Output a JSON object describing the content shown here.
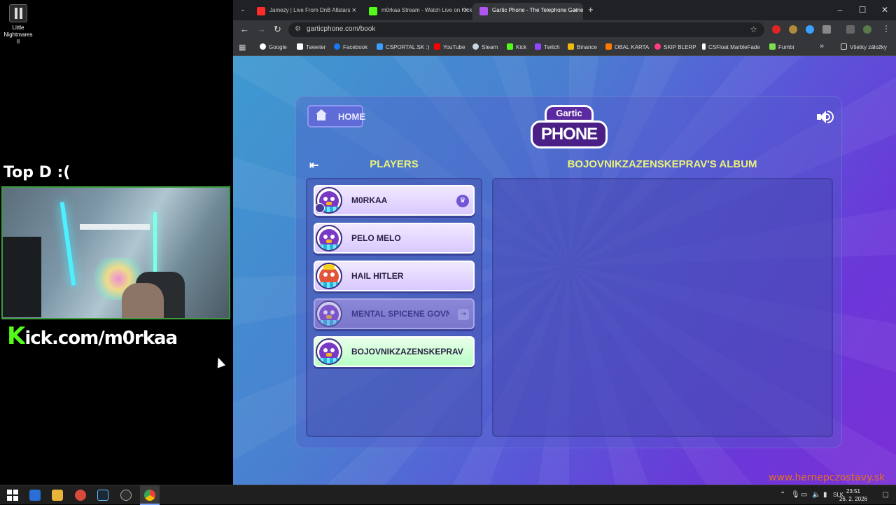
{
  "desktop": {
    "icon_label": "Little Nightmares II",
    "overlay_title": "Top D :(",
    "kick_banner_k": "K",
    "kick_banner_rest": "ick.com/m0rkaa"
  },
  "browser": {
    "tabs": [
      {
        "title": "Jamezy | Live From DnB Allstars",
        "favicon_color": "#ff2a2a",
        "active": false
      },
      {
        "title": "m0rkaa Stream - Watch Live on Kick",
        "favicon_color": "#53fc18",
        "active": false
      },
      {
        "title": "Gartic Phone - The Telephone Game",
        "favicon_color": "#b056f0",
        "active": true
      }
    ],
    "url": "garticphone.com/book",
    "bookmarks": [
      {
        "label": "Google",
        "icon_color": "#ffffff"
      },
      {
        "label": "Tweeter",
        "icon_color": "#ffffff"
      },
      {
        "label": "Facebook",
        "icon_color": "#1877f2"
      },
      {
        "label": "CSPORTAL.SK :)",
        "icon_color": "#3aa0ff"
      },
      {
        "label": "YouTube",
        "icon_color": "#ff0000"
      },
      {
        "label": "Steam",
        "icon_color": "#c7d5e0"
      },
      {
        "label": "Kick",
        "icon_color": "#53fc18"
      },
      {
        "label": "Twitch",
        "icon_color": "#9146ff"
      },
      {
        "label": "Binance",
        "icon_color": "#f0b90b"
      },
      {
        "label": "OBAL KARTA",
        "icon_color": "#ff7a00"
      },
      {
        "label": "SKIP BLERP",
        "icon_color": "#ff3d7f"
      },
      {
        "label": "CSFloat MarbleFade",
        "icon_color": "#ffffff"
      },
      {
        "label": "Fumbi",
        "icon_color": "#7de04a"
      }
    ],
    "other_bookmarks": "Všetky záložky"
  },
  "game": {
    "home_label": "HOME",
    "logo_top": "Gartic",
    "logo_bottom": "PHONE",
    "players_title": "PLAYERS",
    "album_title": "BOJOVNIKZAZENSKEPRAV'S ALBUM",
    "players": [
      {
        "name": "M0RKAA",
        "state": "host"
      },
      {
        "name": "PELO MELO",
        "state": "normal"
      },
      {
        "name": "HAIL HITLER",
        "state": "normal"
      },
      {
        "name": "MENTAL SPICENE GOVN",
        "state": "left"
      },
      {
        "name": "BOJOVNIKZAZENSKEPRAV",
        "state": "selected"
      }
    ],
    "watermark": "www.hernepczostavy.sk",
    "colors": {
      "accent_yellow": "#e9f27a",
      "selected_green": "#b8ffc4",
      "panel_purple": "#5a56d8"
    }
  },
  "taskbar": {
    "language": "SLK",
    "time": "23:51",
    "date": "26. 2. 2026"
  }
}
